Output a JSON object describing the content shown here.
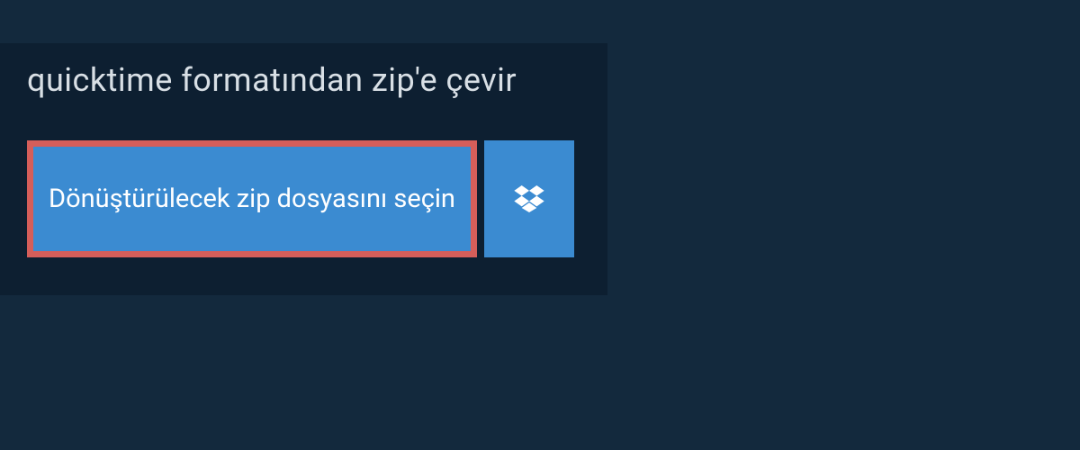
{
  "heading": "quicktime formatından zip'e çevir",
  "select_file_button_label": "Dönüştürülecek zip dosyasını seçin",
  "colors": {
    "background": "#13293d",
    "panel": "#0d1f31",
    "button_bg": "#3b8bd1",
    "button_border": "#d55e5a",
    "text_light": "#d8dfe5",
    "text_white": "#ffffff"
  }
}
